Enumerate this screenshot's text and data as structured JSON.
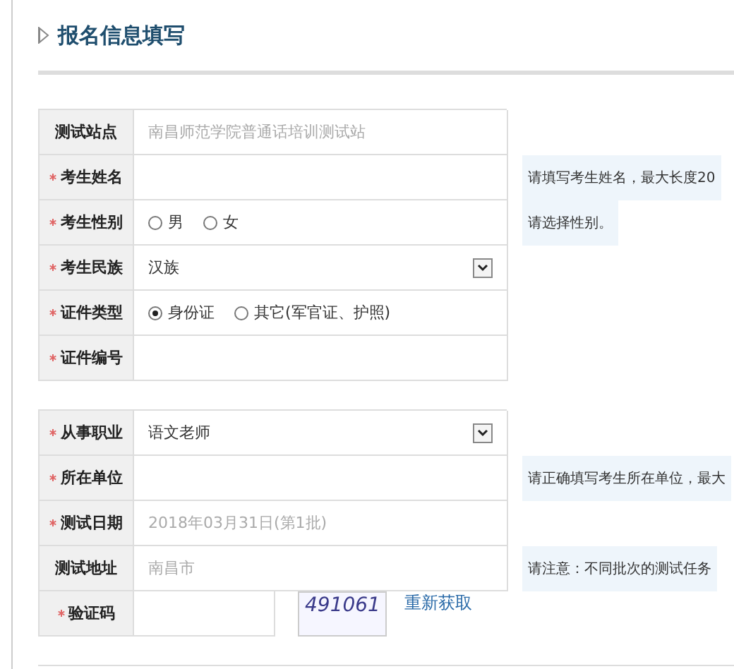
{
  "heading": "报名信息填写",
  "sections": [
    {
      "rows": [
        {
          "kind": "readonly",
          "label": "测试站点",
          "required": false,
          "value": "南昌师范学院普通话培训测试站"
        },
        {
          "kind": "input",
          "label": "考生姓名",
          "required": true,
          "hint": "请填写考生姓名，最大长度20"
        },
        {
          "kind": "radio",
          "label": "考生性别",
          "required": true,
          "options": [
            {
              "label": "男",
              "selected": false
            },
            {
              "label": "女",
              "selected": false
            }
          ],
          "hint": "请选择性别。"
        },
        {
          "kind": "select",
          "label": "考生民族",
          "required": true,
          "value": "汉族"
        },
        {
          "kind": "radio",
          "label": "证件类型",
          "required": true,
          "options": [
            {
              "label": "身份证",
              "selected": true
            },
            {
              "label": "其它(军官证、护照)",
              "selected": false
            }
          ]
        },
        {
          "kind": "input",
          "label": "证件编号",
          "required": true
        }
      ]
    },
    {
      "rows": [
        {
          "kind": "select",
          "label": "从事职业",
          "required": true,
          "value": "语文老师"
        },
        {
          "kind": "input",
          "label": "所在单位",
          "required": true,
          "hint": "请正确填写考生所在单位，最大"
        },
        {
          "kind": "readonly",
          "label": "测试日期",
          "required": true,
          "value": "2018年03月31日(第1批)"
        },
        {
          "kind": "readonly",
          "label": "测试地址",
          "required": false,
          "value": "南昌市",
          "hint": "请注意：不同批次的测试任务"
        },
        {
          "kind": "captcha",
          "label": "验证码",
          "required": true,
          "code": "491061",
          "link": "重新获取"
        }
      ]
    }
  ]
}
